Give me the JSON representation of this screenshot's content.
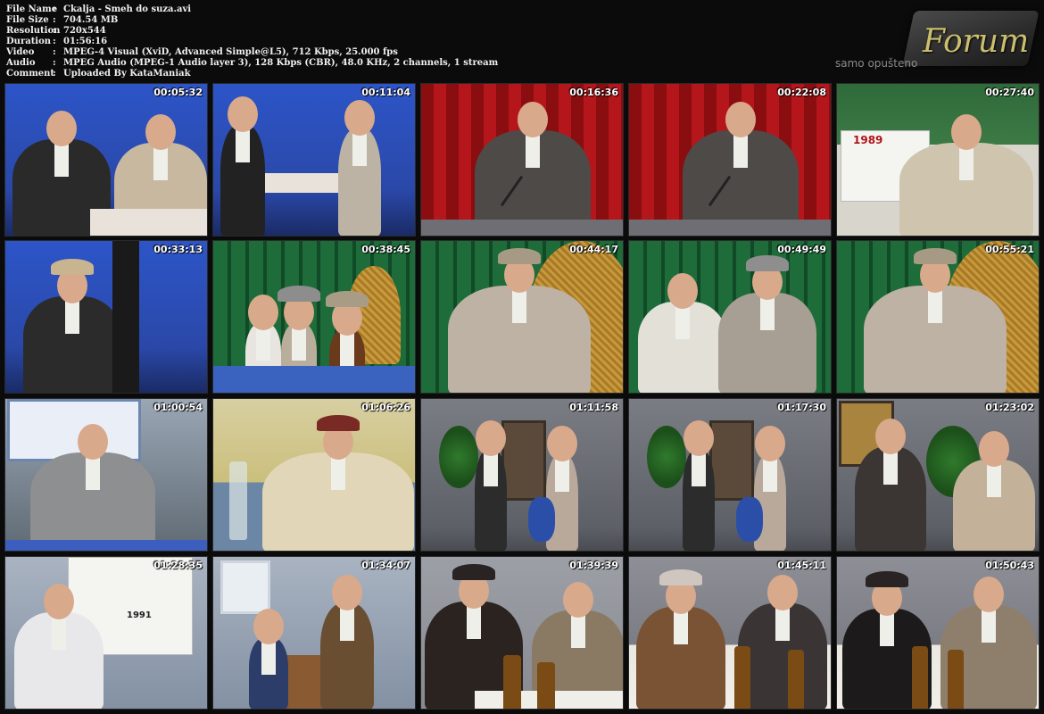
{
  "info": [
    {
      "key": "File Name",
      "value": "Ckalja - Smeh do suza.avi"
    },
    {
      "key": "File Size",
      "value": "704.54 MB"
    },
    {
      "key": "Resolution",
      "value": "720x544"
    },
    {
      "key": "Duration",
      "value": "01:56:16"
    },
    {
      "key": "Video",
      "value": "MPEG-4 Visual (XviD, Advanced Simple@L5), 712 Kbps, 25.000 fps"
    },
    {
      "key": "Audio",
      "value": "MPEG Audio (MPEG-1 Audio layer 3), 128 Kbps (CBR), 48.0 KHz, 2 channels, 1 stream"
    },
    {
      "key": "Comment",
      "value": "Uploaded By KataManiak"
    }
  ],
  "logo": {
    "word": "Forum",
    "tagline": "samo opušteno"
  },
  "calendar_year": "1989",
  "calendar_year_2": "1991",
  "thumbnails": [
    {
      "time": "00:05:32",
      "scene": "blue"
    },
    {
      "time": "00:11:04",
      "scene": "blue"
    },
    {
      "time": "00:16:36",
      "scene": "red"
    },
    {
      "time": "00:22:08",
      "scene": "red"
    },
    {
      "time": "00:27:40",
      "scene": "calendar"
    },
    {
      "time": "00:33:13",
      "scene": "blue"
    },
    {
      "time": "00:38:45",
      "scene": "fence"
    },
    {
      "time": "00:44:17",
      "scene": "fence"
    },
    {
      "time": "00:49:49",
      "scene": "fence"
    },
    {
      "time": "00:55:21",
      "scene": "fence"
    },
    {
      "time": "01:00:54",
      "scene": "room"
    },
    {
      "time": "01:06:26",
      "scene": "kitchen"
    },
    {
      "time": "01:11:58",
      "scene": "grey"
    },
    {
      "time": "01:17:30",
      "scene": "grey"
    },
    {
      "time": "01:23:02",
      "scene": "grey"
    },
    {
      "time": "01:28:35",
      "scene": "office"
    },
    {
      "time": "01:34:07",
      "scene": "office"
    },
    {
      "time": "01:39:39",
      "scene": "lgrey"
    },
    {
      "time": "01:45:11",
      "scene": "table"
    },
    {
      "time": "01:50:43",
      "scene": "table"
    }
  ],
  "colors": {
    "background": "#0b0b0b",
    "text": "#f0f0f0",
    "logo_accent": "#cbbf6e"
  }
}
